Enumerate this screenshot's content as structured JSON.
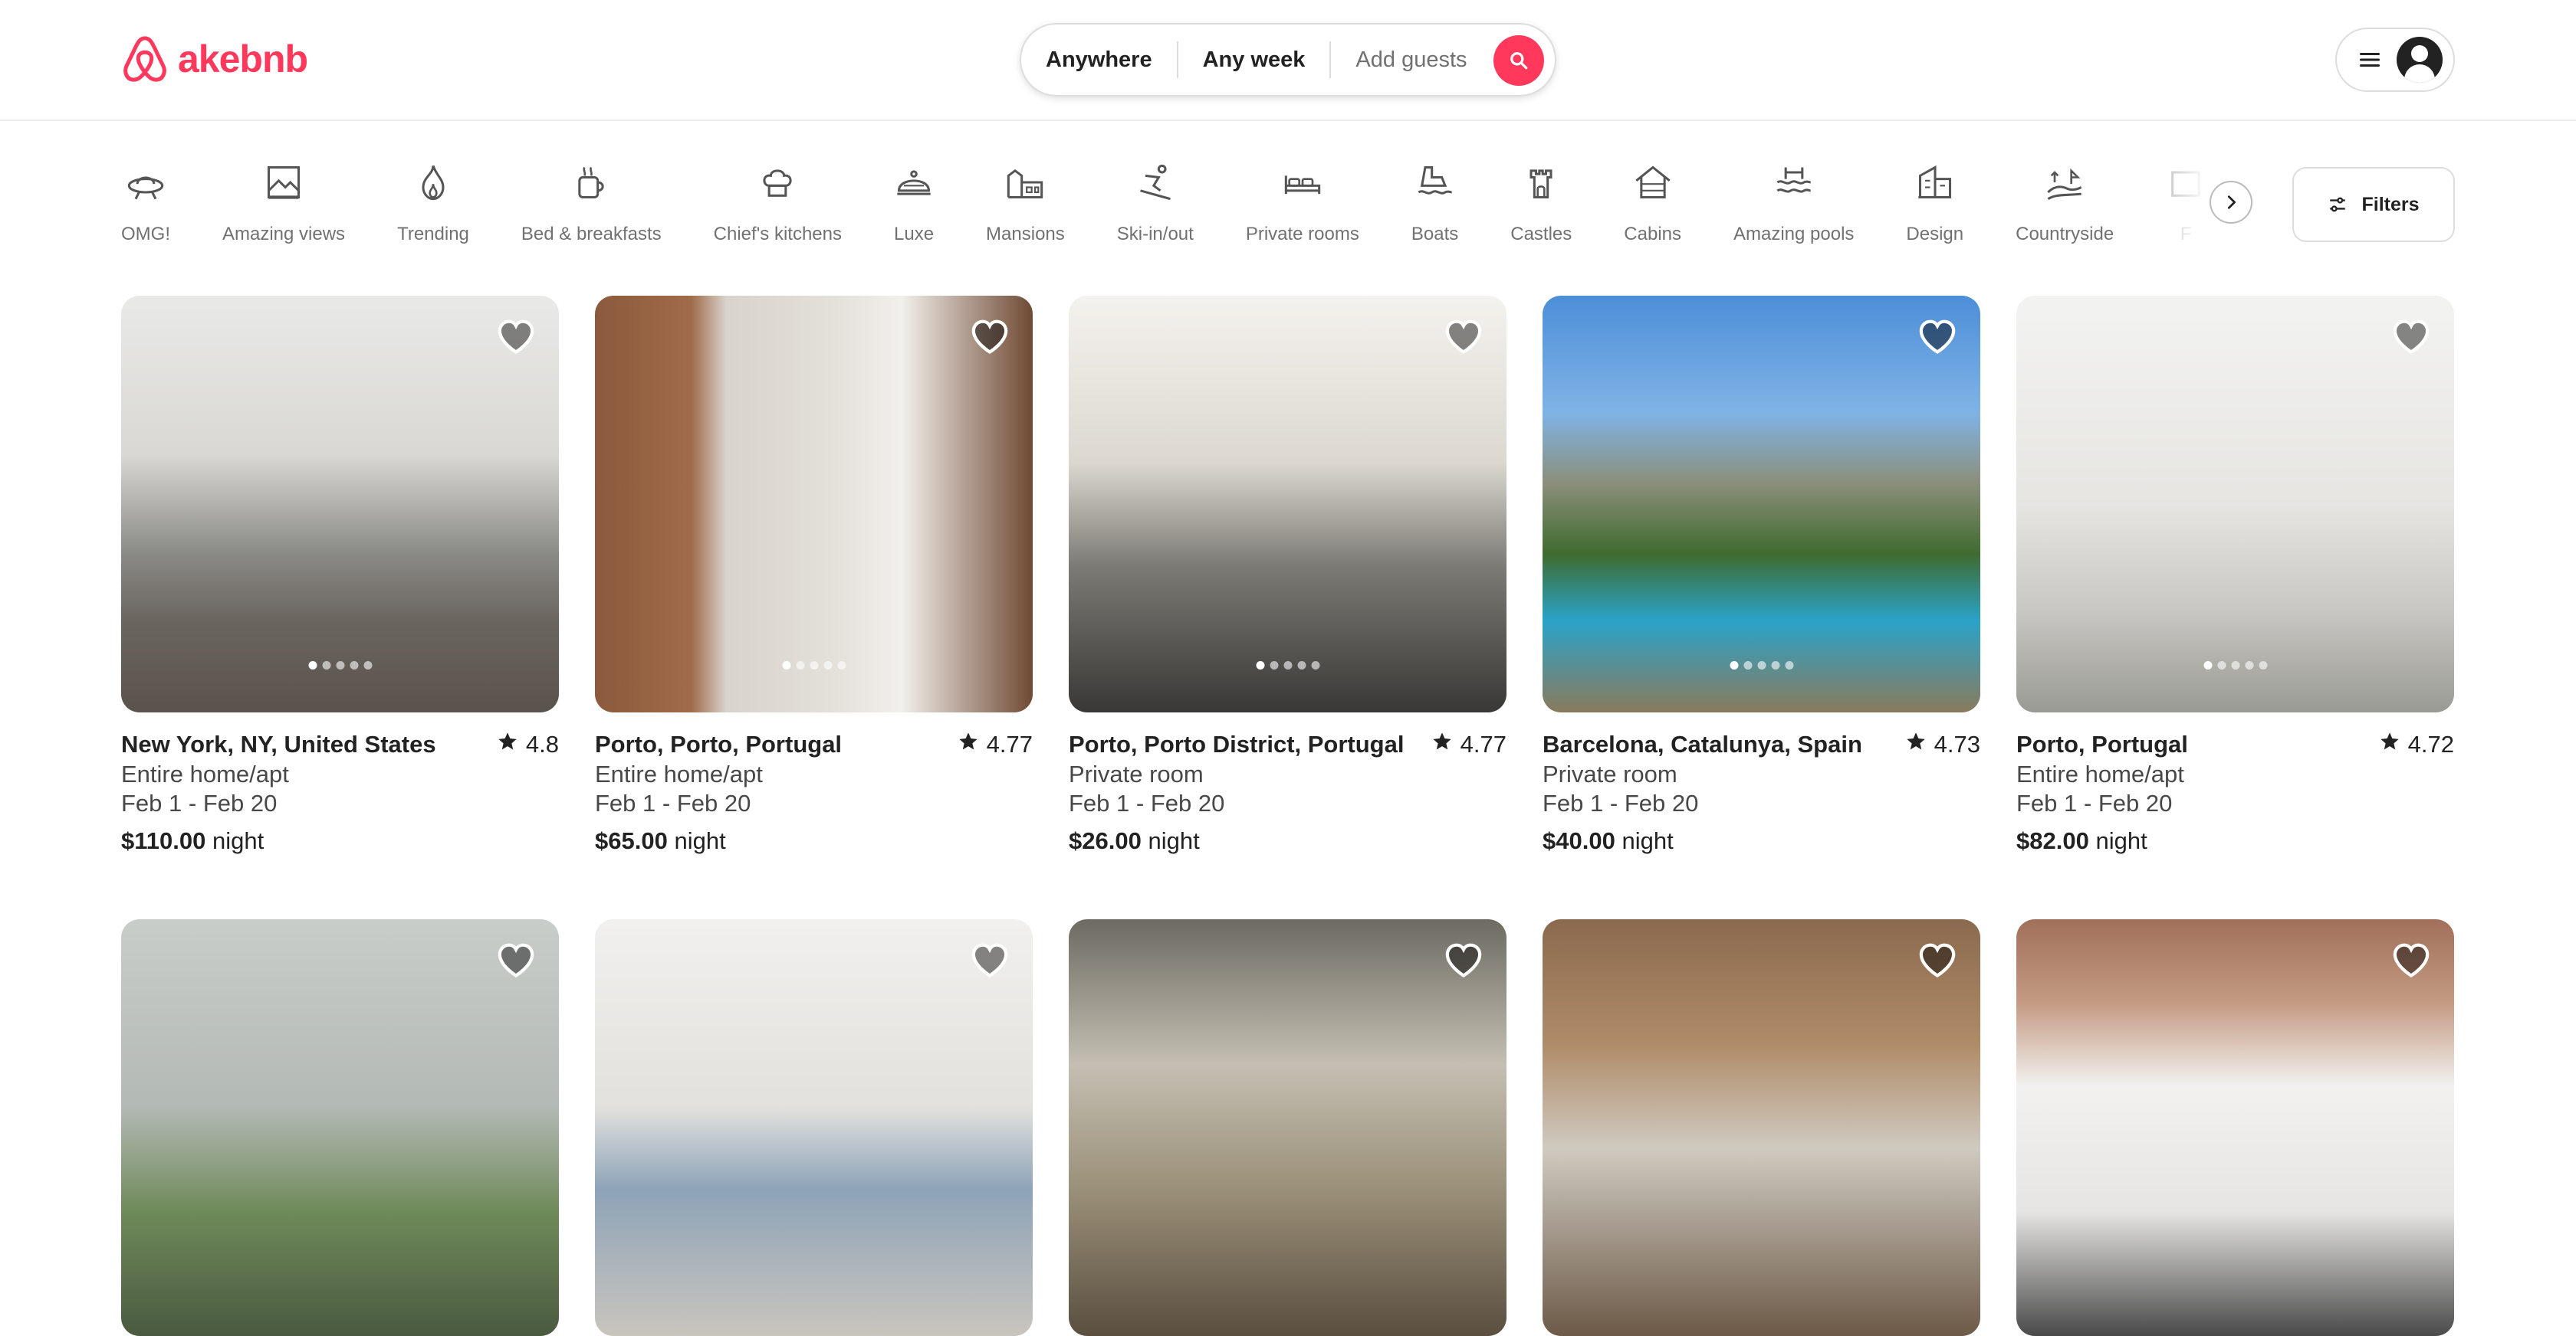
{
  "brand": {
    "name": "akebnb",
    "color": "#ff385c"
  },
  "search": {
    "anywhere": "Anywhere",
    "any_week": "Any week",
    "add_guests": "Add guests",
    "icon": "search-icon"
  },
  "usermenu": {
    "menu_icon": "hamburger-icon",
    "avatar_icon": "user-avatar-icon"
  },
  "categories": [
    {
      "label": "OMG!",
      "icon": "ufo-icon"
    },
    {
      "label": "Amazing views",
      "icon": "framed-landscape-icon"
    },
    {
      "label": "Trending",
      "icon": "flame-icon"
    },
    {
      "label": "Bed & breakfasts",
      "icon": "coffee-mug-icon"
    },
    {
      "label": "Chief's kitchens",
      "icon": "chef-hat-icon"
    },
    {
      "label": "Luxe",
      "icon": "bell-cloche-icon"
    },
    {
      "label": "Mansions",
      "icon": "mansion-icon"
    },
    {
      "label": "Ski-in/out",
      "icon": "skier-icon"
    },
    {
      "label": "Private rooms",
      "icon": "bed-icon"
    },
    {
      "label": "Boats",
      "icon": "boat-icon"
    },
    {
      "label": "Castles",
      "icon": "castle-icon"
    },
    {
      "label": "Cabins",
      "icon": "cabin-icon"
    },
    {
      "label": "Amazing pools",
      "icon": "pool-icon"
    },
    {
      "label": "Design",
      "icon": "building-icon"
    },
    {
      "label": "Countryside",
      "icon": "countryside-icon"
    },
    {
      "label": "F",
      "icon": "partial-category-icon"
    }
  ],
  "filters": {
    "label": "Filters",
    "icon": "sliders-icon"
  },
  "listings": [
    {
      "title": "New York, NY, United States",
      "rating": "4.8",
      "type": "Entire home/apt",
      "dates": "Feb 1 - Feb 20",
      "price": "$110.00",
      "unit": "night"
    },
    {
      "title": "Porto, Porto, Portugal",
      "rating": "4.77",
      "type": "Entire home/apt",
      "dates": "Feb 1 - Feb 20",
      "price": "$65.00",
      "unit": "night"
    },
    {
      "title": "Porto, Porto District, Portugal",
      "rating": "4.77",
      "type": "Private room",
      "dates": "Feb 1 - Feb 20",
      "price": "$26.00",
      "unit": "night"
    },
    {
      "title": "Barcelona, Catalunya, Spain",
      "rating": "4.73",
      "type": "Private room",
      "dates": "Feb 1 - Feb 20",
      "price": "$40.00",
      "unit": "night"
    },
    {
      "title": "Porto, Portugal",
      "rating": "4.72",
      "type": "Entire home/apt",
      "dates": "Feb 1 - Feb 20",
      "price": "$82.00",
      "unit": "night"
    },
    {
      "title": "",
      "rating": "",
      "type": "",
      "dates": "",
      "price": "",
      "unit": ""
    },
    {
      "title": "",
      "rating": "",
      "type": "",
      "dates": "",
      "price": "",
      "unit": ""
    },
    {
      "title": "",
      "rating": "",
      "type": "",
      "dates": "",
      "price": "",
      "unit": ""
    },
    {
      "title": "",
      "rating": "",
      "type": "",
      "dates": "",
      "price": "",
      "unit": ""
    },
    {
      "title": "",
      "rating": "",
      "type": "",
      "dates": "",
      "price": "",
      "unit": ""
    }
  ]
}
